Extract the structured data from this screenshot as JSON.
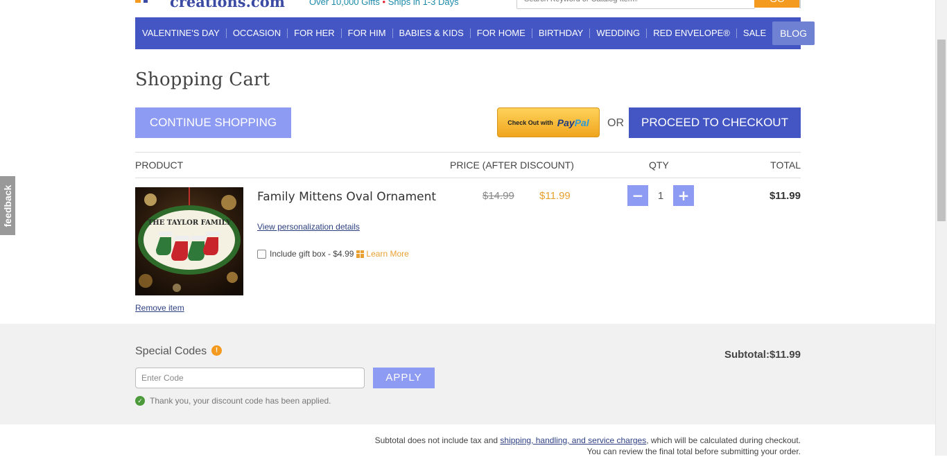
{
  "header": {
    "logo_text": "creations.com",
    "tagline_part1": "Over 10,000 Gifts",
    "tagline_bullet": "•",
    "tagline_part2": "Ships in 1-3 Days",
    "search_placeholder": "Search Keyword or Catalog Item#",
    "search_button": "GO"
  },
  "nav": {
    "items": [
      "VALENTINE'S DAY",
      "OCCASION",
      "FOR HER",
      "FOR HIM",
      "BABIES & KIDS",
      "FOR HOME",
      "BIRTHDAY",
      "WEDDING",
      "RED ENVELOPE®",
      "SALE"
    ],
    "blog": "BLOG"
  },
  "cart": {
    "title": "Shopping Cart",
    "continue_label": "CONTINUE SHOPPING",
    "paypal_prefix": "Check Out with",
    "paypal_brand_1": "Pay",
    "paypal_brand_2": "Pal",
    "or_label": "OR",
    "checkout_label": "PROCEED TO CHECKOUT",
    "columns": {
      "product": "PRODUCT",
      "price": "PRICE (AFTER DISCOUNT)",
      "qty": "QTY",
      "total": "TOTAL"
    },
    "item": {
      "name": "Family Mittens Oval Ornament",
      "old_price": "$14.99",
      "new_price": "$11.99",
      "qty": "1",
      "total": "$11.99",
      "view_details": "View personalization details",
      "giftbox_label": "Include gift box - $4.99",
      "learn_more": "Learn More",
      "remove": "Remove item",
      "ornament_title": "THE TAYLOR FAMILY"
    }
  },
  "codes": {
    "title": "Special Codes",
    "info": "!",
    "placeholder": "Enter Code",
    "apply": "APPLY",
    "message": "Thank you, your discount code has been applied.",
    "subtotal": "Subtotal:$11.99"
  },
  "note": {
    "line1_pre": "Subtotal does not include tax and",
    "line1_link": "shipping, handling, and service charges",
    "line1_post": ", which will be calculated during checkout.",
    "line2": "You can review the final total before submitting your order."
  },
  "feedback": "feedback",
  "colors": {
    "nav": "#4356c3",
    "button_light": "#8d9bf2",
    "accent": "#e8a030",
    "success": "#4c9a3a"
  }
}
